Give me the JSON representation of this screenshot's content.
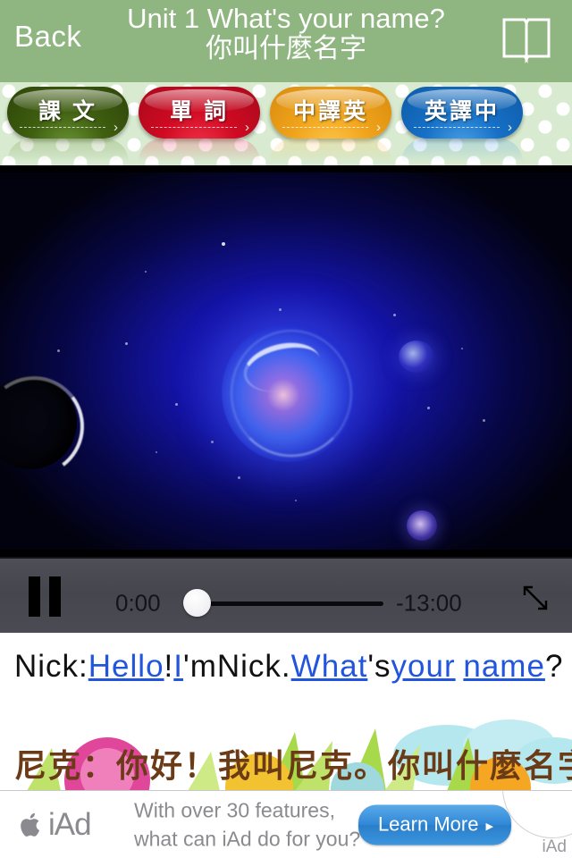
{
  "header": {
    "back_label": "Back",
    "title_en": "Unit 1 What's your name?",
    "title_zh": "你叫什麼名字",
    "book_icon": "open-book-icon",
    "bg_color": "#8fb580"
  },
  "tabs": [
    {
      "label": "課 文",
      "color": "#3f5f10",
      "name": "tab-text"
    },
    {
      "label": "單 詞",
      "color": "#cf0a22",
      "name": "tab-vocabulary"
    },
    {
      "label": "中譯英",
      "color": "#f0a41c",
      "name": "tab-chinese-to-english"
    },
    {
      "label": "英譯中",
      "color": "#1670c6",
      "name": "tab-english-to-chinese"
    }
  ],
  "player": {
    "state": "playing",
    "pause_icon": "pause-icon",
    "elapsed": "0:00",
    "remaining": "-13:00",
    "progress_percent": 0,
    "fullscreen_icon": "fullscreen-expand-icon",
    "bar_color": "#4a4a52"
  },
  "subtitles": {
    "english_segments": [
      {
        "text": "Nick:",
        "link": false
      },
      {
        "text": "Hello",
        "link": true
      },
      {
        "text": "!",
        "link": false
      },
      {
        "text": "I",
        "link": true
      },
      {
        "text": "'m",
        "link": false
      },
      {
        "text": "Nick",
        "link": false
      },
      {
        "text": ".",
        "link": false
      },
      {
        "text": "What",
        "link": true
      },
      {
        "text": "'s",
        "link": false
      },
      {
        "text": "your",
        "link": true
      },
      {
        "text": " ",
        "link": false
      },
      {
        "text": "name",
        "link": true
      },
      {
        "text": "?",
        "link": false
      }
    ],
    "chinese": "尼克：你好！我叫尼克。你叫什麼名字",
    "link_color": "#2255dd",
    "text_color": "#111111",
    "chinese_color": "#6b3a16"
  },
  "ad": {
    "brand": "iAd",
    "apple_icon": "apple-logo-icon",
    "copy_line1": "With over 30 features,",
    "copy_line2": "what can iAd do for you?",
    "cta_label": "Learn More",
    "cta_chevron": "▸",
    "corner_label": "iAd",
    "cta_color": "#2f87d6"
  }
}
